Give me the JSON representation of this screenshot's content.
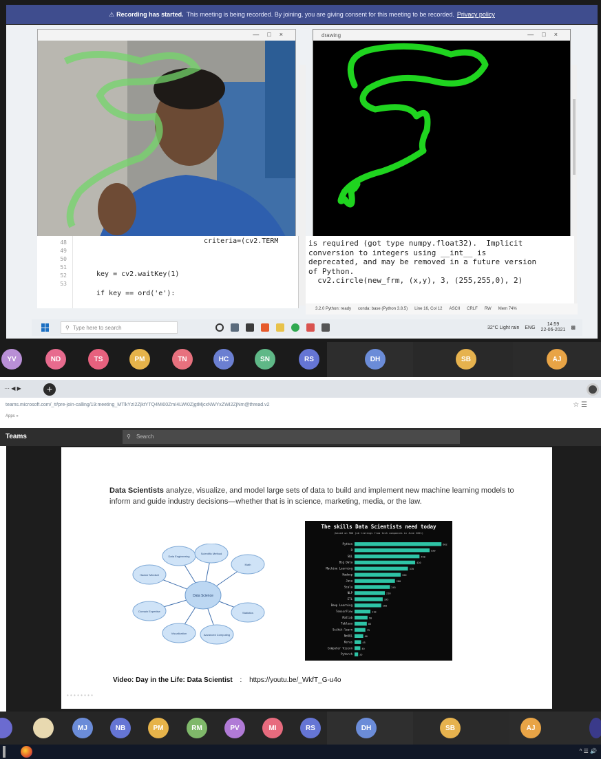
{
  "recording_banner": {
    "bold": "Recording has started.",
    "text": "This meeting is being recorded. By joining, you are giving consent for this meeting to be recorded.",
    "link": "Privacy policy"
  },
  "camera_window": {
    "title": ""
  },
  "drawing_window": {
    "title": "drawing"
  },
  "code_left": {
    "line_numbers": [
      "48",
      "49",
      "50",
      "51",
      "52",
      "53"
    ],
    "lines": [
      "criteria=(cv2.TERM",
      "",
      "",
      "key = cv2.waitKey(1)",
      "",
      "if key == ord('e'):"
    ]
  },
  "code_right": {
    "lines": [
      "is required (got type numpy.float32).  Implicit",
      "conversion to integers using __int__ is",
      "deprecated, and may be removed in a future version",
      "of Python.",
      "  cv2.circle(new_frm, (x,y), 3, (255,255,0), 2)"
    ]
  },
  "ide_status": [
    "3.2.0 Python: ready",
    "conda: base (Python 3.8.5)",
    "Line 16, Col 12",
    "ASCII",
    "CRLF",
    "RW",
    "Mem 74%"
  ],
  "taskbar": {
    "search_placeholder": "Type here to search",
    "weather": "32°C Light rain",
    "lang": "ENG",
    "time": "14:59",
    "date": "22-06-2021"
  },
  "top_participants": [
    {
      "initials": "YV",
      "color": "#b98fd6"
    },
    {
      "initials": "ND",
      "color": "#e76b8e"
    },
    {
      "initials": "TS",
      "color": "#e7617e"
    },
    {
      "initials": "PM",
      "color": "#e6b34a"
    },
    {
      "initials": "TN",
      "color": "#e7717e"
    },
    {
      "initials": "HC",
      "color": "#6b7fd1"
    },
    {
      "initials": "SN",
      "color": "#5fb887"
    },
    {
      "initials": "RS",
      "color": "#6575d4"
    },
    {
      "initials": "DH",
      "color": "#6b8cd8"
    },
    {
      "initials": "SB",
      "color": "#e6b24e"
    },
    {
      "initials": "AJ",
      "color": "#e8a446"
    }
  ],
  "browser": {
    "tab_controls": "··· ◀ ▶",
    "new_tab": "+",
    "url": "teams.microsoft.com/_#/pre-join-calling/19:meeting_MTlkYzI2ZjktYTQ4Mi00ZmI4LWI0ZjgtMjcxNWYxZWI2ZjNm@thread.v2",
    "bookmarks": "Apps »"
  },
  "teams": {
    "title": "Teams",
    "search_placeholder": "Search"
  },
  "slide": {
    "para_bold": "Data Scientists",
    "para_text": " analyze, visualize, and model large sets of data to build and implement new machine learning models to inform and guide industry decisions—whether that is in science, marketing, media, or the law.",
    "video_label": "Video: Day in the Life: Data Scientist",
    "video_sep": ":",
    "video_url": "https://youtu.be/_WkfT_G-u4o",
    "watermark": "• • • • • • • •"
  },
  "mindmap": {
    "center": "Data Science",
    "nodes": [
      "Data Engineering",
      "Scientific Method",
      "Math",
      "Statistics",
      "Advanced Computing",
      "Visualization",
      "Domain Expertise",
      "Hacker Mindset"
    ]
  },
  "chart_data": {
    "type": "bar",
    "title": "The skills Data Scientists need today",
    "subtitle": "(based on 900 job listings from tech companies in June 2021)",
    "categories": [
      "Python",
      "R",
      "SQL",
      "Big Data",
      "Machine Learning",
      "Hadoop",
      "Java",
      "Scala",
      "NLP",
      "ETL",
      "Deep Learning",
      "TensorFlow",
      "Matlab",
      "Tableau",
      "Scikit-learn",
      "NoSQL",
      "Keras",
      "Computer Vision",
      "Pytorch"
    ],
    "values": [
      602,
      520,
      450,
      420,
      370,
      320,
      280,
      245,
      210,
      195,
      185,
      110,
      90,
      85,
      75,
      60,
      45,
      40,
      25
    ]
  },
  "bottom_participants": [
    {
      "initials": "",
      "color": "#e8d9b0"
    },
    {
      "initials": "MJ",
      "color": "#6b8cd8"
    },
    {
      "initials": "NB",
      "color": "#6575d4"
    },
    {
      "initials": "PM",
      "color": "#e6b34a"
    },
    {
      "initials": "RM",
      "color": "#7fb86a"
    },
    {
      "initials": "PV",
      "color": "#b07ad6"
    },
    {
      "initials": "MI",
      "color": "#e76b7e"
    },
    {
      "initials": "RS",
      "color": "#6575d4"
    },
    {
      "initials": "DH",
      "color": "#6b8cd8"
    },
    {
      "initials": "SB",
      "color": "#e6b24e"
    },
    {
      "initials": "AJ",
      "color": "#e8a446"
    }
  ],
  "win_tray": "^ ☰ 🔊"
}
